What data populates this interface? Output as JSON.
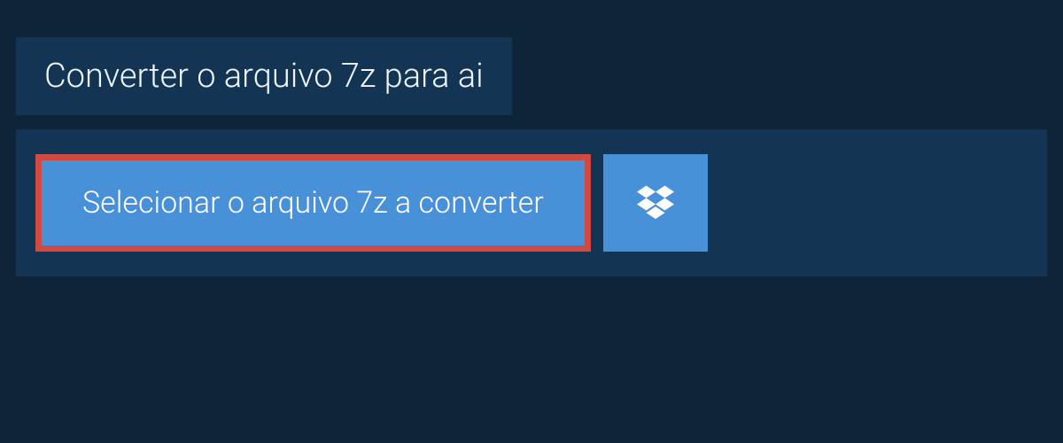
{
  "tab": {
    "title": "Converter o arquivo 7z para ai"
  },
  "actions": {
    "select_file_label": "Selecionar o arquivo 7z a converter"
  },
  "colors": {
    "background": "#0e2439",
    "panel": "#133453",
    "button_bg": "#4890d7",
    "highlight_border": "#d14a41"
  }
}
